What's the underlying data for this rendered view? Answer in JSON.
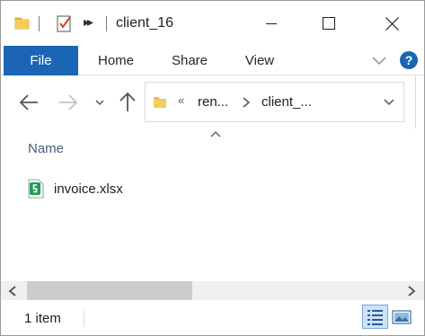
{
  "window": {
    "title": "client_16"
  },
  "ribbon": {
    "tabs": [
      {
        "label": "File",
        "active": true
      },
      {
        "label": "Home",
        "active": false
      },
      {
        "label": "Share",
        "active": false
      },
      {
        "label": "View",
        "active": false
      }
    ],
    "help_label": "?"
  },
  "address": {
    "overflow": "«",
    "segments": [
      "ren...",
      "client_..."
    ]
  },
  "sort": {
    "symbol": "^"
  },
  "list": {
    "column_header": "Name",
    "files": [
      {
        "name": "invoice.xlsx",
        "icon": "spreadsheet-icon"
      }
    ]
  },
  "status": {
    "item_count": "1 item"
  },
  "colors": {
    "accent": "#1b66b4",
    "header_text": "#4a5b78",
    "folder_yellow": "#e8b83f",
    "excel_green": "#1f9d55"
  }
}
